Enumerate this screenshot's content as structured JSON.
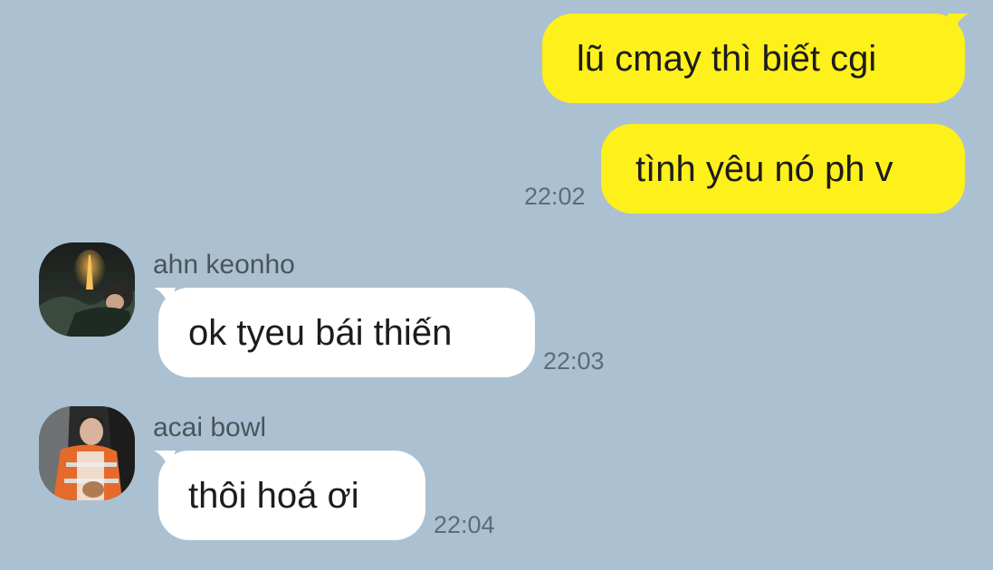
{
  "colors": {
    "background": "#abc1d1",
    "outgoing_bubble": "#fef01b",
    "incoming_bubble": "#ffffff",
    "timestamp": "#5e6c78",
    "sender_name": "#4a545c",
    "message_text": "#1c1c1c"
  },
  "messages": [
    {
      "direction": "outgoing",
      "text": "lũ cmay thì biết cgi"
    },
    {
      "direction": "outgoing",
      "text": "tình yêu nó ph v",
      "time": "22:02"
    },
    {
      "direction": "incoming",
      "sender": "ahn keonho",
      "avatar_icon": "user-photo-night-tower",
      "text": "ok tyeu bái thiến",
      "time": "22:03"
    },
    {
      "direction": "incoming",
      "sender": "acai bowl",
      "avatar_icon": "user-photo-orange-jacket",
      "text": "thôi hoá ơi",
      "time": "22:04"
    }
  ]
}
